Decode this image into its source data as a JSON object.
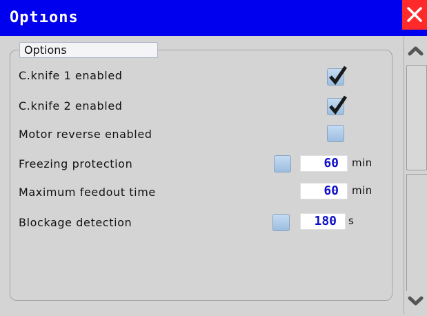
{
  "window": {
    "title": "Optıons"
  },
  "options_group": {
    "label": "Options"
  },
  "rows": {
    "cknife1": {
      "label": "C.knife 1 enabled",
      "checked": true
    },
    "cknife2": {
      "label": "C.knife 2 enabled",
      "checked": true
    },
    "motor_reverse": {
      "label": "Motor reverse enabled",
      "checked": false
    },
    "freezing": {
      "label": "Freezing protection",
      "checked": false,
      "value": "60",
      "unit": "min"
    },
    "feedout": {
      "label": "Maximum feedout time",
      "value": "60",
      "unit": "min"
    },
    "blockage": {
      "label": "Blockage detection",
      "checked": false,
      "value": "180",
      "unit": "s"
    }
  },
  "colors": {
    "titlebar": "#0000ee",
    "close": "#ff2a2a",
    "value_text": "#1010c8",
    "background": "#d4d4d4"
  },
  "icons": {
    "close": "close-icon",
    "check": "checkmark-icon",
    "scroll_up": "chevron-up-icon",
    "scroll_down": "chevron-down-icon"
  }
}
